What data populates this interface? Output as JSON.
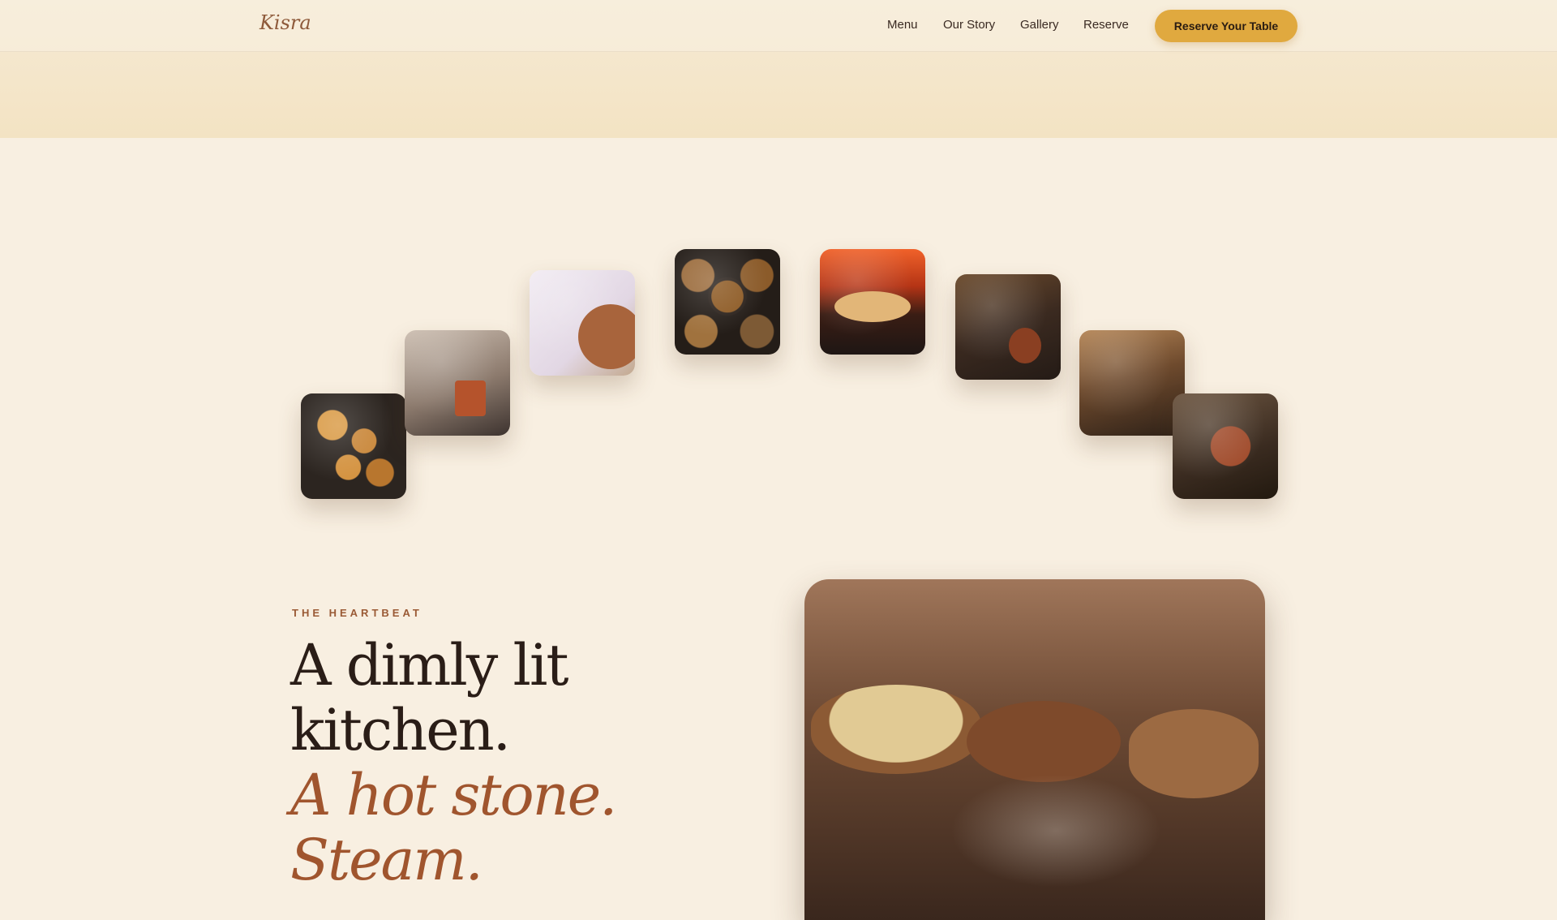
{
  "nav": {
    "logo": "Kisra",
    "links": [
      {
        "label": "Menu"
      },
      {
        "label": "Our Story"
      },
      {
        "label": "Gallery"
      },
      {
        "label": "Reserve"
      }
    ],
    "cta": "Reserve Your Table"
  },
  "gallery": {
    "images": [
      {
        "name": "gallery-image-dates"
      },
      {
        "name": "gallery-image-clay-pot-fire"
      },
      {
        "name": "gallery-image-spice-bowl"
      },
      {
        "name": "gallery-image-dishes-platter"
      },
      {
        "name": "gallery-image-bread-oven"
      },
      {
        "name": "gallery-image-coffee-pot"
      },
      {
        "name": "gallery-image-baskets"
      },
      {
        "name": "gallery-image-roast-feast"
      }
    ]
  },
  "heartbeat": {
    "eyebrow": "THE HEARTBEAT",
    "line1": "A dimly lit",
    "line2": "kitchen.",
    "line3": "A hot stone.",
    "line4": "Steam."
  },
  "colors": {
    "accent": "#e0a93f",
    "brand": "#8e5a3a",
    "headline_italic": "#a0552e"
  }
}
